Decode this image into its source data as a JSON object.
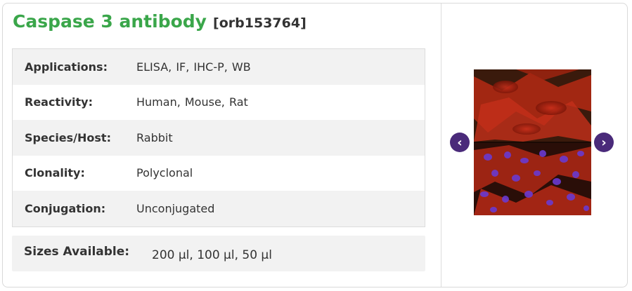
{
  "product": {
    "title": "Caspase 3 antibody",
    "code": "[orb153764]"
  },
  "specs": [
    {
      "label": "Applications:",
      "value": "ELISA,  IF,  IHC-P,  WB"
    },
    {
      "label": "Reactivity:",
      "value": "Human, Mouse, Rat"
    },
    {
      "label": "Species/Host:",
      "value": "Rabbit"
    },
    {
      "label": "Clonality:",
      "value": "Polyclonal"
    },
    {
      "label": "Conjugation:",
      "value": "Unconjugated"
    }
  ],
  "sizes": {
    "label": "Sizes Available:",
    "value": "200 µl, 100 µl, 50 µl"
  },
  "gallery": {
    "prev_icon": "chevron-left-icon",
    "next_icon": "chevron-right-icon",
    "prev_glyph": "‹",
    "next_glyph": "›"
  },
  "colors": {
    "title": "#3aa64a",
    "nav_button": "#4a2a7a"
  }
}
